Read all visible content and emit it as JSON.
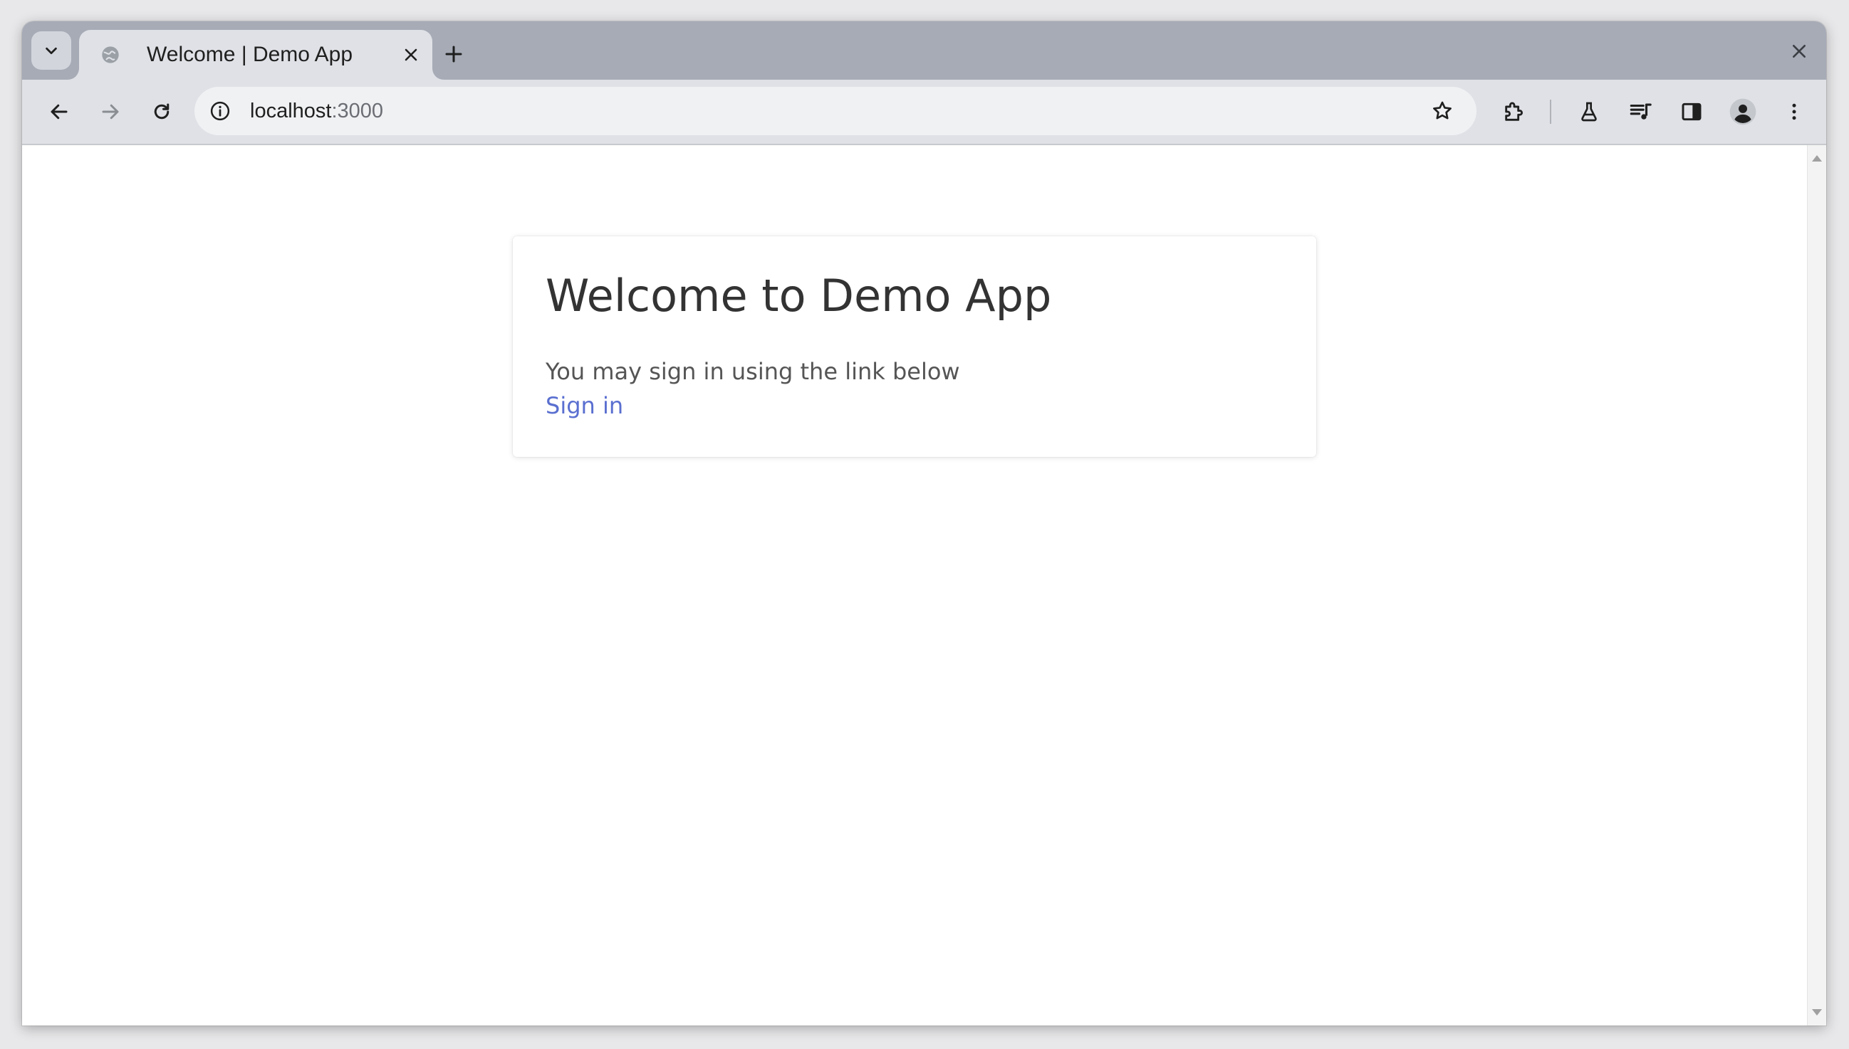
{
  "browser": {
    "tab": {
      "title": "Welcome | Demo App",
      "favicon": "globe-icon"
    },
    "address_bar": {
      "host": "localhost",
      "port": ":3000"
    },
    "icons": {
      "tab_search": "chevron-down-icon",
      "tab_close": "close-icon",
      "new_tab": "plus-icon",
      "window_close": "close-icon",
      "back": "arrow-left-icon",
      "forward": "arrow-right-icon",
      "reload": "reload-icon",
      "site_info": "info-icon",
      "bookmark": "star-icon",
      "extensions": "puzzle-icon",
      "labs": "flask-icon",
      "media": "playlist-icon",
      "side_panel": "side-panel-icon",
      "profile": "profile-icon",
      "menu": "kebab-menu-icon"
    }
  },
  "page": {
    "heading": "Welcome to Demo App",
    "message": "You may sign in using the link below",
    "sign_in_link": "Sign in"
  },
  "colors": {
    "tabstrip": "#a6abb6",
    "toolbar": "#dfe1e6",
    "link": "#5a6fd0",
    "heading": "#333333"
  }
}
